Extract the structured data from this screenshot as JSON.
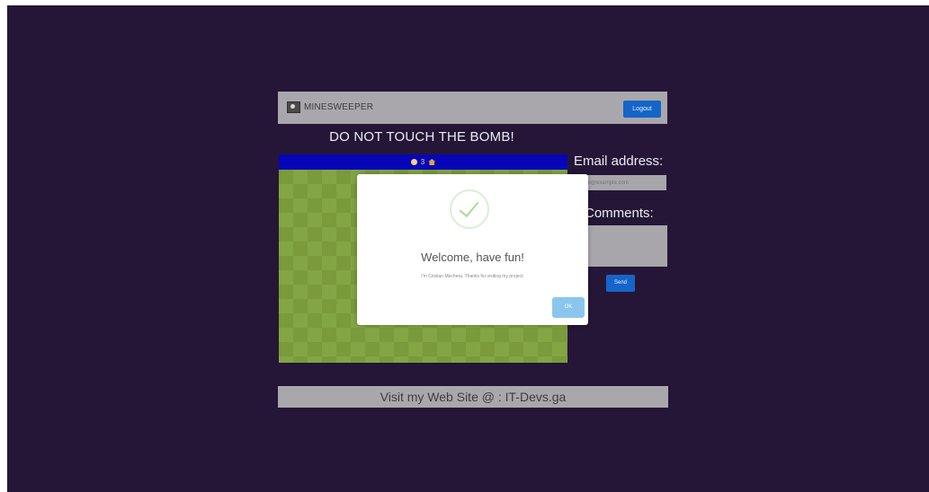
{
  "navbar": {
    "brand": "MINESWEEPER",
    "logout_label": "Logout"
  },
  "game": {
    "headline": "DO NOT TOUCH THE BOMB!",
    "counter": "3"
  },
  "contact": {
    "email_label": "Email address:",
    "email_placeholder": "name@example.com",
    "comments_label": "Comments:",
    "send_label": "Send"
  },
  "footer": {
    "text": "Visit my Web Site @ : IT-Devs.ga"
  },
  "modal": {
    "title": "Welcome, have fun!",
    "text": "I'm Cristian Mechera. Thanks for visiting my project.",
    "ok_label": "OK"
  },
  "colors": {
    "background": "#251638",
    "panel": "#a9a7ac",
    "accent": "#1565c9",
    "game_header": "#0606b8",
    "board": "#7a9a3b",
    "success": "#a8dc95"
  },
  "icons": [
    "minesweeper-logo-icon",
    "flag-icon",
    "home-icon",
    "success-check-icon"
  ]
}
